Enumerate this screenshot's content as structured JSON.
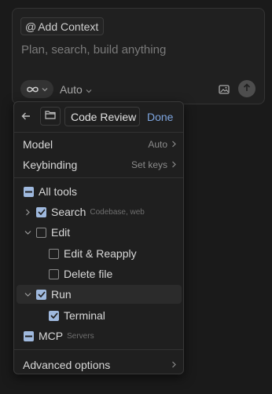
{
  "composer": {
    "add_context_prefix": "@",
    "add_context_label": "Add Context",
    "placeholder": "Plan, search, build anything",
    "mode_icon": "infinity-icon",
    "model_label": "Auto"
  },
  "panel": {
    "name_value": "Code Review",
    "done_label": "Done",
    "settings": [
      {
        "label": "Model",
        "value": "Auto"
      },
      {
        "label": "Keybinding",
        "value": "Set keys"
      }
    ],
    "tools": {
      "all_label": "All tools",
      "search_label": "Search",
      "search_sub": "Codebase, web",
      "edit_label": "Edit",
      "edit_reapply_label": "Edit & Reapply",
      "delete_file_label": "Delete file",
      "run_label": "Run",
      "terminal_label": "Terminal",
      "mcp_label": "MCP",
      "mcp_sub": "Servers"
    },
    "advanced_label": "Advanced options"
  },
  "colors": {
    "accent": "#9fb9de",
    "done": "#7ea6e0",
    "background": "#1a1a1a"
  }
}
